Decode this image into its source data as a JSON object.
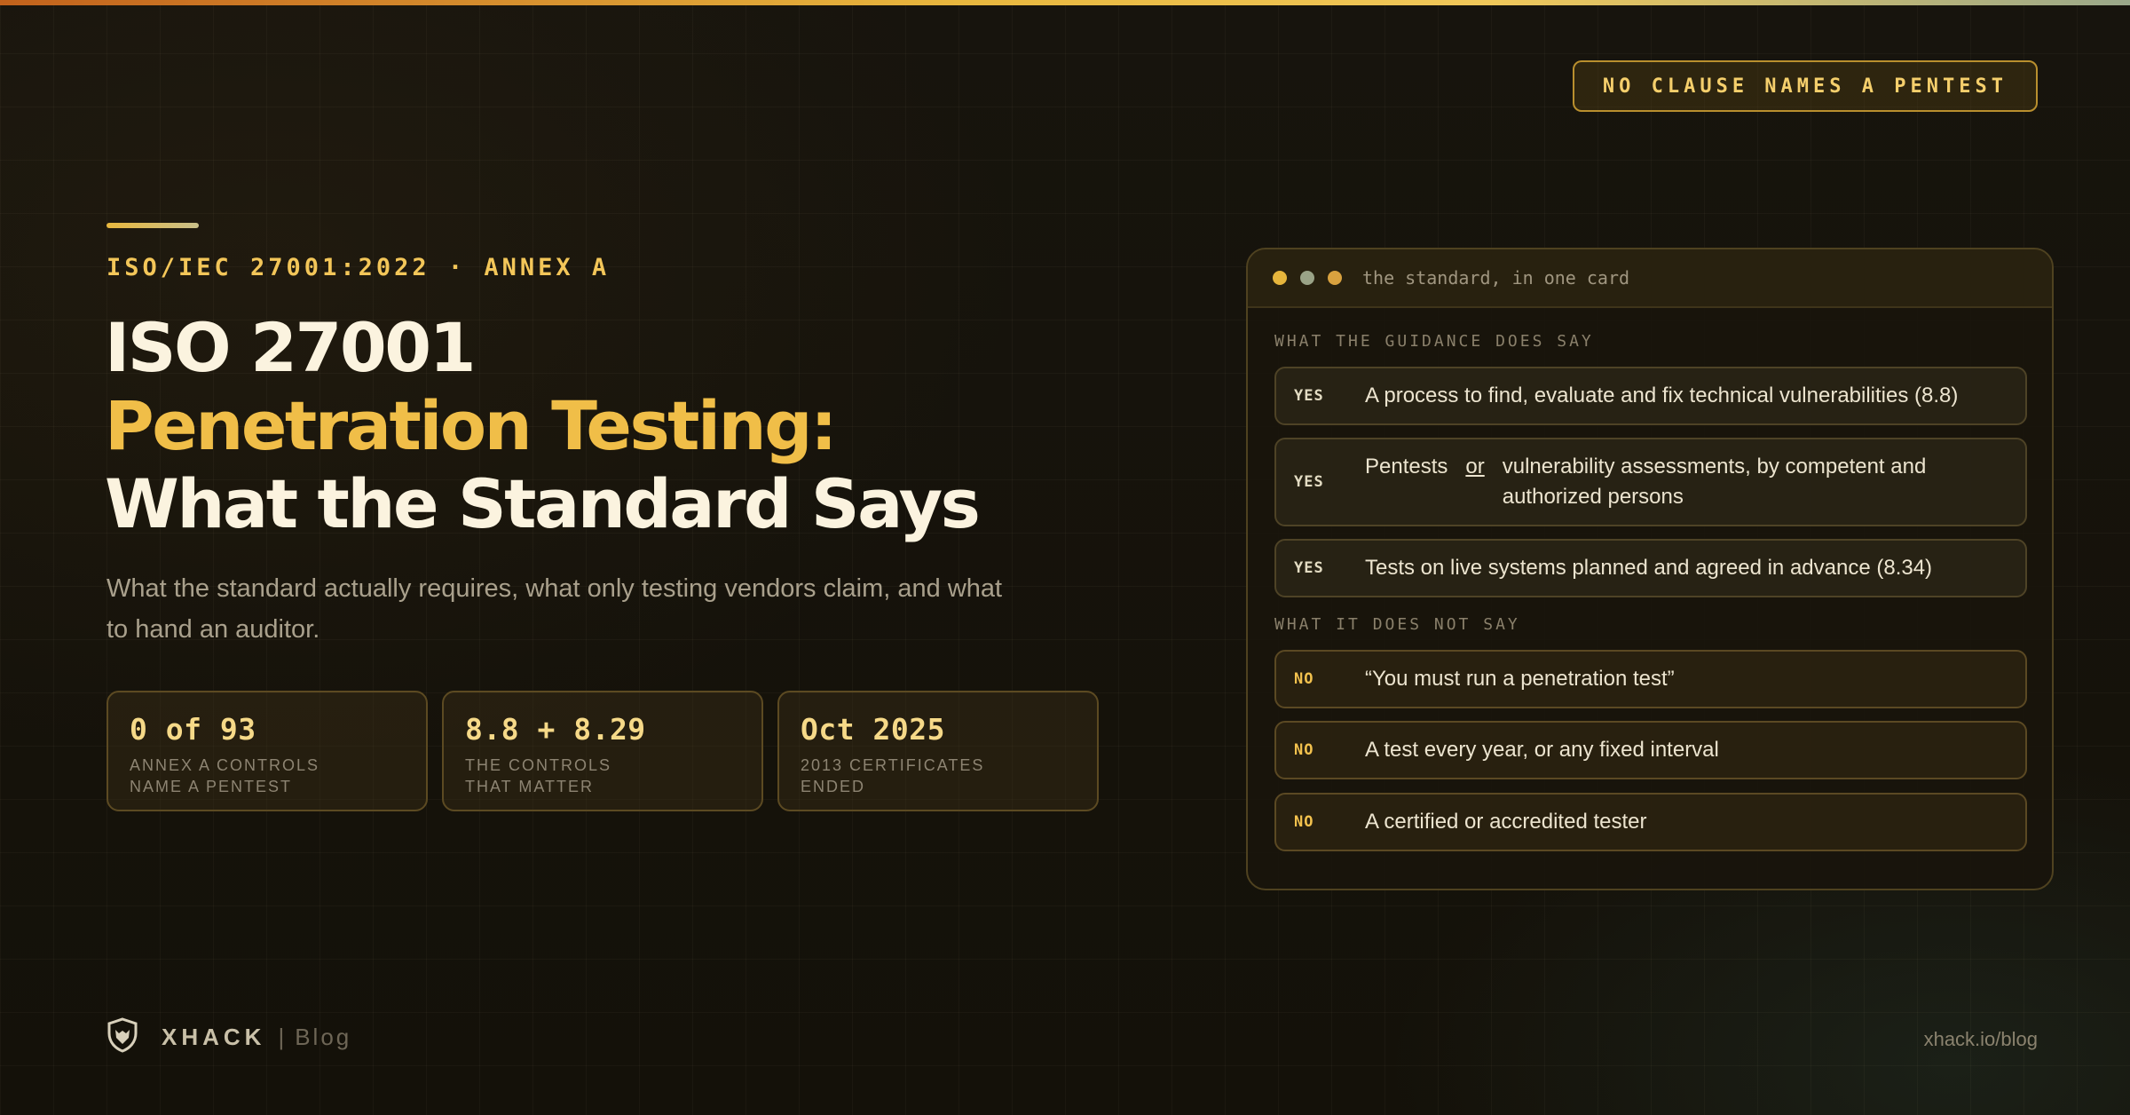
{
  "badge": "NO CLAUSE NAMES A PENTEST",
  "eyebrow": "ISO/IEC 27001:2022 · ANNEX A",
  "title": {
    "line1": "ISO 27001",
    "line2": "Penetration Testing:",
    "line3": "What the Standard Says"
  },
  "subtitle": "What the standard actually requires, what only testing vendors claim, and what to hand an auditor.",
  "stats": [
    {
      "value": "0 of 93",
      "label": "ANNEX A CONTROLS\nNAME A PENTEST"
    },
    {
      "value": "8.8 + 8.29",
      "label": "THE CONTROLS\nTHAT MATTER"
    },
    {
      "value": "Oct 2025",
      "label": "2013 CERTIFICATES\nENDED"
    }
  ],
  "card": {
    "title": "the standard, in one card",
    "dots": [
      "#e6b53c",
      "#9aa387",
      "#d9a23f"
    ],
    "section_yes": "WHAT THE GUIDANCE DOES SAY",
    "section_no": "WHAT IT DOES NOT SAY",
    "yes_rows": [
      {
        "tag": "YES",
        "text": "A process to find, evaluate and fix technical vulnerabilities (8.8)"
      },
      {
        "tag": "YES",
        "text_a": "Pentests",
        "or": "or",
        "text_b": "vulnerability assessments, by competent and authorized persons"
      },
      {
        "tag": "YES",
        "text": "Tests on live systems planned and agreed in advance (8.34)"
      }
    ],
    "no_rows": [
      {
        "tag": "NO",
        "text": "“You must run a penetration test”"
      },
      {
        "tag": "NO",
        "text": "A test every year, or any fixed interval"
      },
      {
        "tag": "NO",
        "text": "A certified or accredited tester"
      }
    ]
  },
  "footer": {
    "brand": "XHACK",
    "separator": "|",
    "section": "Blog",
    "url": "xhack.io/blog"
  }
}
